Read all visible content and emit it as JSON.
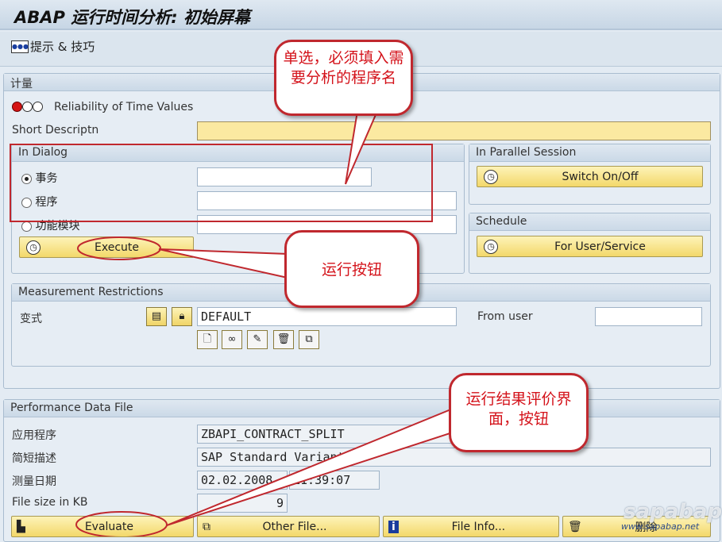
{
  "window": {
    "title": "ABAP 运行时间分析: 初始屏幕"
  },
  "toolbar": {
    "tips_label": "提示 & 技巧",
    "tips_icon": "tips-icon"
  },
  "measurement": {
    "header": "计量",
    "reliability_label": "Reliability of Time Values",
    "reliability_status": "red",
    "short_desc_label": "Short Descriptn",
    "short_desc_value": "",
    "in_dialog": {
      "header": "In Dialog",
      "options": [
        {
          "label": "事务",
          "selected": true,
          "value": ""
        },
        {
          "label": "程序",
          "selected": false,
          "value": ""
        },
        {
          "label": "功能模块",
          "selected": false,
          "value": ""
        }
      ],
      "execute_label": "Execute"
    },
    "parallel": {
      "header": "In Parallel Session",
      "button_label": "Switch On/Off"
    },
    "schedule": {
      "header": "Schedule",
      "button_label": "For User/Service"
    },
    "restrictions": {
      "header": "Measurement Restrictions",
      "variant_label": "变式",
      "variant_value": "DEFAULT",
      "from_user_label": "From user",
      "from_user_value": ""
    }
  },
  "perf_file": {
    "header": "Performance Data File",
    "rows": [
      {
        "label": "应用程序",
        "value": "ZBAPI_CONTRACT_SPLIT"
      },
      {
        "label": "简短描述",
        "value": "SAP Standard Variant"
      },
      {
        "label": "测量日期",
        "value": "02.02.2008",
        "time": "11:39:07"
      },
      {
        "label": "File size in KB",
        "value": "9"
      }
    ],
    "buttons": {
      "evaluate": "Evaluate",
      "other_file": "Other File...",
      "file_info": "File Info...",
      "delete": "删除"
    }
  },
  "annotations": {
    "callout1": "单选，必须填入需要分析的程序名",
    "callout2": "运行按钮",
    "callout3": "运行结果评价界面，按钮",
    "color": "#c0282e"
  },
  "watermark": {
    "logo": "sapabap",
    "url": "www.sapabap.net"
  }
}
